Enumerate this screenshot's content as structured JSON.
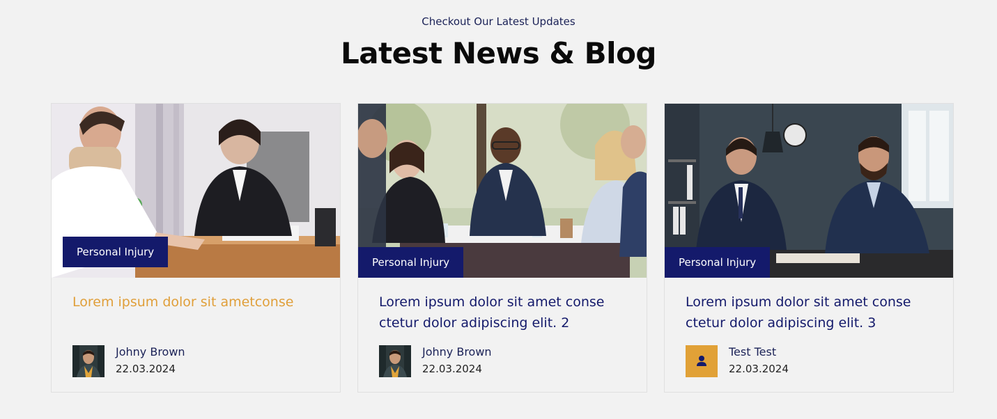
{
  "section": {
    "eyebrow": "Checkout Our Latest Updates",
    "title": "Latest News & Blog"
  },
  "colors": {
    "navy": "#141a6b",
    "accent": "#e09f3a",
    "background": "#f2f2f2"
  },
  "posts": [
    {
      "category": "Personal Injury",
      "title": "Lorem ipsum dolor sit ametconse",
      "author": "Johny Brown",
      "date": "22.03.2024",
      "avatar_icon": "author-photo-icon"
    },
    {
      "category": "Personal Injury",
      "title": "Lorem ipsum dolor sit amet conse ctetur dolor adipiscing elit. 2",
      "author": "Johny Brown",
      "date": "22.03.2024",
      "avatar_icon": "author-photo-icon"
    },
    {
      "category": "Personal Injury",
      "title": "Lorem ipsum dolor sit amet conse ctetur dolor adipiscing elit. 3",
      "author": "Test Test",
      "date": "22.03.2024",
      "avatar_icon": "user-icon"
    }
  ]
}
